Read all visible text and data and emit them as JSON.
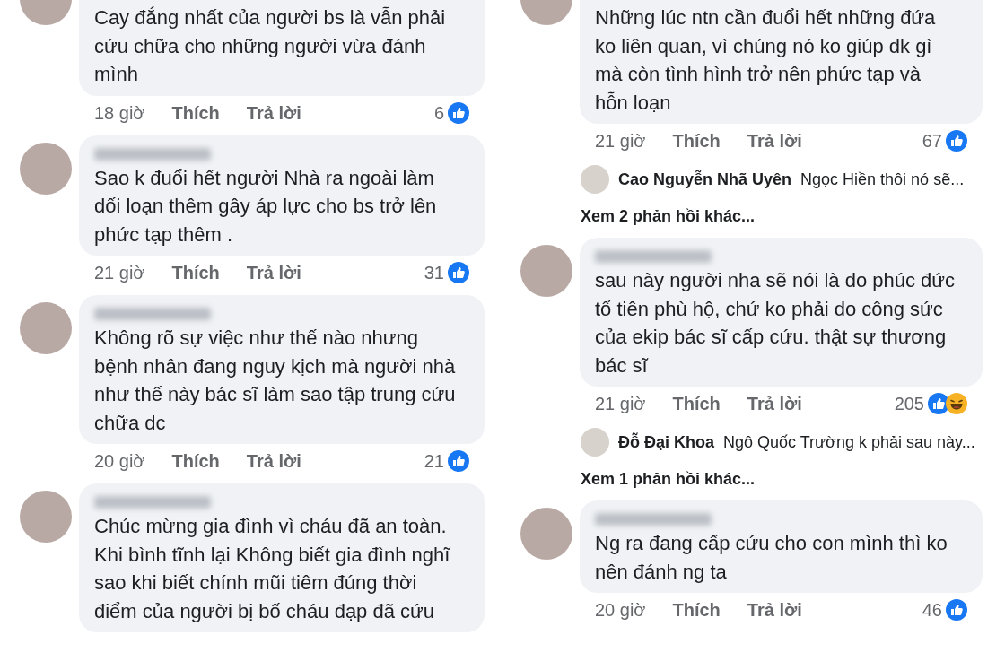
{
  "columns": [
    {
      "items": [
        {
          "kind": "comment",
          "name_blurred": false,
          "text": "Cay đắng nhất của người bs là vẫn phải cứu chữa cho những người vừa đánh mình",
          "time": "18 giờ",
          "like": "Thích",
          "reply": "Trả lời",
          "count": "6",
          "reactions": [
            {
              "kind": "like"
            }
          ]
        },
        {
          "kind": "comment",
          "name_blurred": true,
          "text": "Sao k đuổi hết người Nhà ra ngoài  làm dối loạn thêm gây áp lực cho bs   trở lên phức tạp thêm .",
          "time": "21 giờ",
          "like": "Thích",
          "reply": "Trả lời",
          "count": "31",
          "reactions": [
            {
              "kind": "like"
            }
          ]
        },
        {
          "kind": "comment",
          "name_blurred": true,
          "text": "Không rõ sự việc như thế nào nhưng bệnh nhân đang nguy kịch mà người nhà như thế này bác sĩ làm sao tập trung cứu chữa dc",
          "time": "20 giờ",
          "like": "Thích",
          "reply": "Trả lời",
          "count": "21",
          "reactions": [
            {
              "kind": "like"
            }
          ]
        },
        {
          "kind": "comment",
          "name_blurred": true,
          "text": "Chúc mừng gia đình vì cháu đã an toàn. Khi bình tĩnh lại Không biết gia đình nghĩ sao khi biết chính mũi tiêm đúng thời điểm của người bị bố cháu đạp đã cứu"
        }
      ]
    },
    {
      "items": [
        {
          "kind": "comment",
          "name_blurred": false,
          "text": "Những lúc ntn cần đuổi hết những đứa ko liên quan, vì chúng nó ko giúp dk gì mà còn tình hình trở nên phức tạp và hỗn loạn",
          "time": "21 giờ",
          "like": "Thích",
          "reply": "Trả lời",
          "count": "67",
          "reactions": [
            {
              "kind": "like"
            }
          ]
        },
        {
          "kind": "reply",
          "author": "Cao Nguyễn Nhã Uyên",
          "text": "Ngọc Hiền thôi nó sẽ..."
        },
        {
          "kind": "more",
          "text": "Xem 2 phản hồi khác..."
        },
        {
          "kind": "comment",
          "name_blurred": true,
          "text": "sau này người nha sẽ nói là do phúc đức tổ tiên phù hộ, chứ ko phải do công sức của ekip bác sĩ cấp cứu. thật sự thương bác sĩ",
          "time": "21 giờ",
          "like": "Thích",
          "reply": "Trả lời",
          "count": "205",
          "reactions": [
            {
              "kind": "like"
            },
            {
              "kind": "haha"
            }
          ]
        },
        {
          "kind": "reply",
          "author": "Đỗ Đại Khoa",
          "text": "Ngô Quốc Trường k phải sau này..."
        },
        {
          "kind": "more",
          "text": "Xem 1 phản hồi khác..."
        },
        {
          "kind": "comment",
          "name_blurred": true,
          "text": "Ng ra đang cấp cứu cho con mình thì ko nên đánh ng ta",
          "time": "20 giờ",
          "like": "Thích",
          "reply": "Trả lời",
          "count": "46",
          "reactions": [
            {
              "kind": "like"
            }
          ]
        }
      ]
    }
  ]
}
